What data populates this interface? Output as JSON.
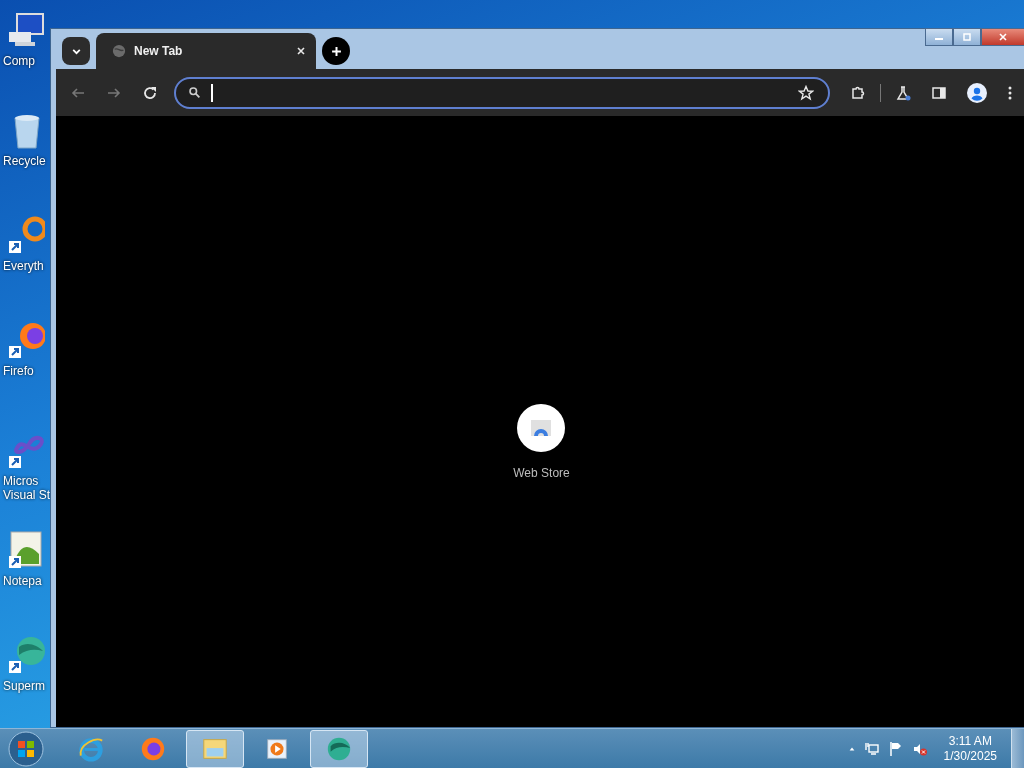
{
  "desktop_icons": [
    {
      "kind": "computer",
      "label": "Comp"
    },
    {
      "kind": "recycle",
      "label": "Recycle"
    },
    {
      "kind": "search-app",
      "label": "Everyth"
    },
    {
      "kind": "firefox",
      "label": "Firefo"
    },
    {
      "kind": "infinity",
      "label": "Micros Visual St"
    },
    {
      "kind": "notepad",
      "label": "Notepa"
    },
    {
      "kind": "globe",
      "label": "Superm"
    }
  ],
  "browser": {
    "tabs": [
      {
        "title": "New Tab",
        "selected": true
      }
    ],
    "address_bar": {
      "focused": true
    },
    "shortcuts": [
      {
        "label": "Web Store"
      }
    ]
  },
  "taskbar": {
    "items": [
      {
        "kind": "ie",
        "selected": false
      },
      {
        "kind": "firefox",
        "selected": false
      },
      {
        "kind": "explorer",
        "selected": true
      },
      {
        "kind": "media",
        "selected": false
      },
      {
        "kind": "globe",
        "selected": true
      }
    ],
    "clock": {
      "time": "3:11 AM",
      "date": "1/30/2025"
    }
  }
}
